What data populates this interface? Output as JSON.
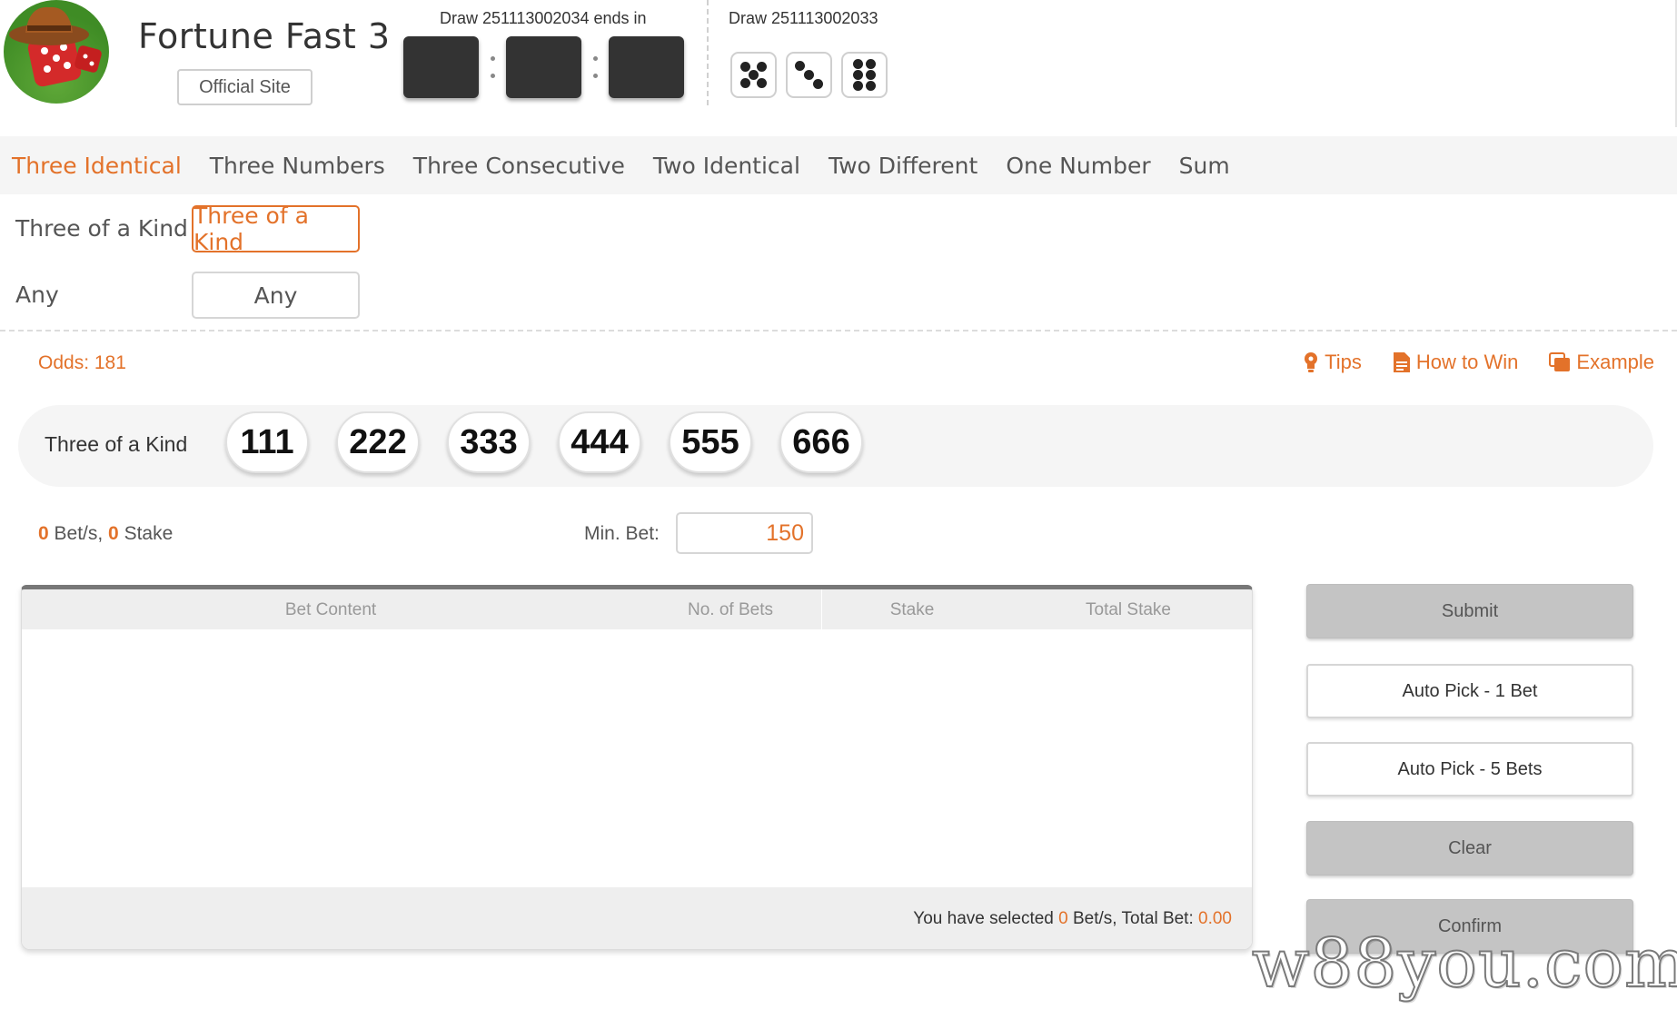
{
  "header": {
    "game_title": "Fortune Fast 3",
    "official_site_label": "Official Site",
    "current_draw_label": "Draw 251113002034 ends in",
    "previous_draw_label": "Draw 251113002033",
    "previous_result_dice": [
      5,
      3,
      6
    ],
    "countdown": [
      "",
      "",
      ""
    ]
  },
  "tabs": [
    {
      "label": "Three Identical",
      "active": true
    },
    {
      "label": "Three Numbers",
      "active": false
    },
    {
      "label": "Three Consecutive",
      "active": false
    },
    {
      "label": "Two Identical",
      "active": false
    },
    {
      "label": "Two Different",
      "active": false
    },
    {
      "label": "One Number",
      "active": false
    },
    {
      "label": "Sum",
      "active": false
    }
  ],
  "sub_options": [
    {
      "label": "Three of a Kind",
      "button": "Three of a Kind",
      "active": true
    },
    {
      "label": "Any",
      "button": "Any",
      "active": false
    }
  ],
  "odds_label": "Odds: 181",
  "help_links": [
    {
      "label": "Tips",
      "icon": "lightbulb-icon"
    },
    {
      "label": "How to Win",
      "icon": "document-icon"
    },
    {
      "label": "Example",
      "icon": "copy-icon"
    }
  ],
  "pick_row": {
    "label": "Three of a Kind",
    "balls": [
      "111",
      "222",
      "333",
      "444",
      "555",
      "666"
    ]
  },
  "bet_summary": {
    "bets": "0",
    "bets_suffix": " Bet/s, ",
    "stake": "0",
    "stake_suffix": " Stake",
    "min_bet_label": "Min. Bet:",
    "min_bet_value": "150"
  },
  "table": {
    "columns": [
      "Bet Content",
      "No. of Bets",
      "Stake",
      "Total Stake"
    ],
    "footer_prefix": "You have selected ",
    "footer_bets": "0",
    "footer_mid": " Bet/s, Total Bet: ",
    "footer_total": "0.00"
  },
  "actions": {
    "submit": "Submit",
    "auto_pick_1": "Auto Pick - 1 Bet",
    "auto_pick_5": "Auto Pick - 5 Bets",
    "clear": "Clear",
    "confirm": "Confirm"
  },
  "watermark": "w88you.com",
  "colors": {
    "accent": "#e3722a",
    "countdown_box": "#333333",
    "button_grey": "#c4c4c4"
  }
}
